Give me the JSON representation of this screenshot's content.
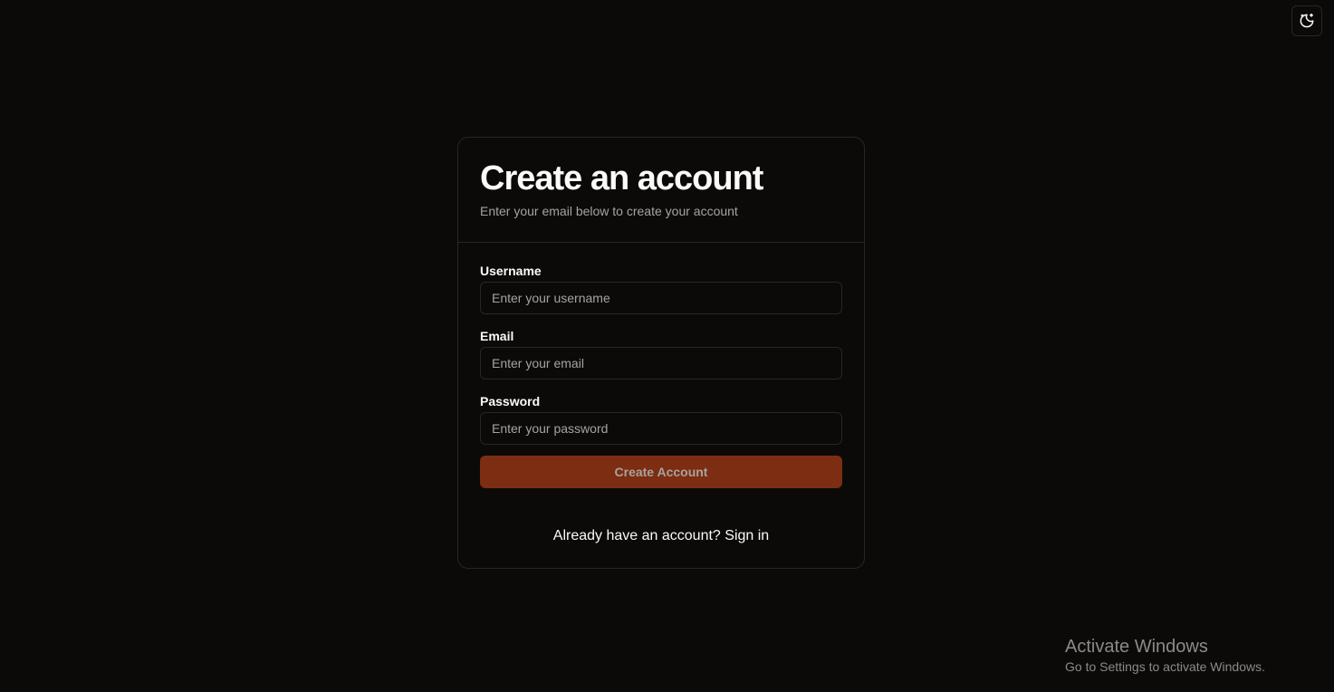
{
  "header": {
    "theme_toggle_icon": "moon-stars-icon"
  },
  "card": {
    "title": "Create an account",
    "subtitle": "Enter your email below to create your account",
    "fields": [
      {
        "label": "Username",
        "placeholder": "Enter your username",
        "value": ""
      },
      {
        "label": "Email",
        "placeholder": "Enter your email",
        "value": ""
      },
      {
        "label": "Password",
        "placeholder": "Enter your password",
        "value": ""
      }
    ],
    "submit_label": "Create Account",
    "signin_prompt": "Already have an account?",
    "signin_link": "Sign in"
  },
  "watermark": {
    "title": "Activate Windows",
    "subtitle": "Go to Settings to activate Windows."
  },
  "colors": {
    "background": "#0c0a09",
    "border": "#292524",
    "accent": "#7c2d12",
    "muted_text": "#a8a29e",
    "text": "#fafaf9"
  }
}
